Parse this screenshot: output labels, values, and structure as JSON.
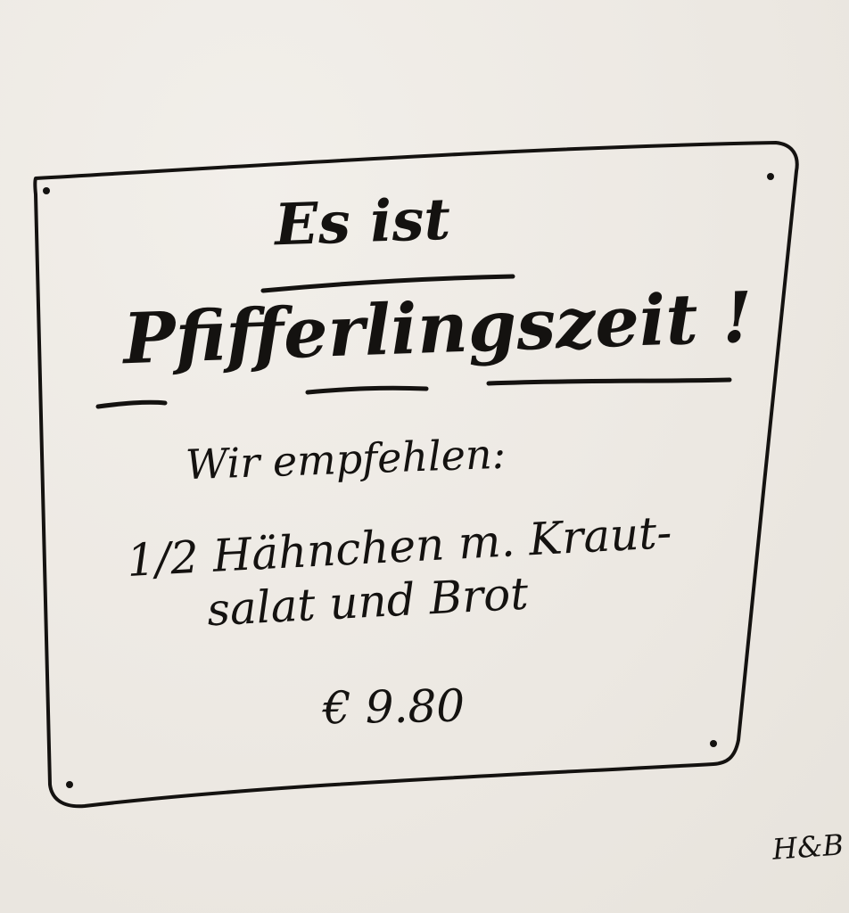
{
  "sign": {
    "title_line1": "Es ist",
    "title_line2": "Pfifferlingszeit !",
    "recommend": "Wir empfehlen:",
    "dish_line1": "1/2 Hähnchen m. Kraut-",
    "dish_line2": "salat und Brot",
    "price": "€ 9.80"
  },
  "signature": "H&B",
  "colors": {
    "ink": "#141210",
    "paper": "#eeebe6"
  }
}
